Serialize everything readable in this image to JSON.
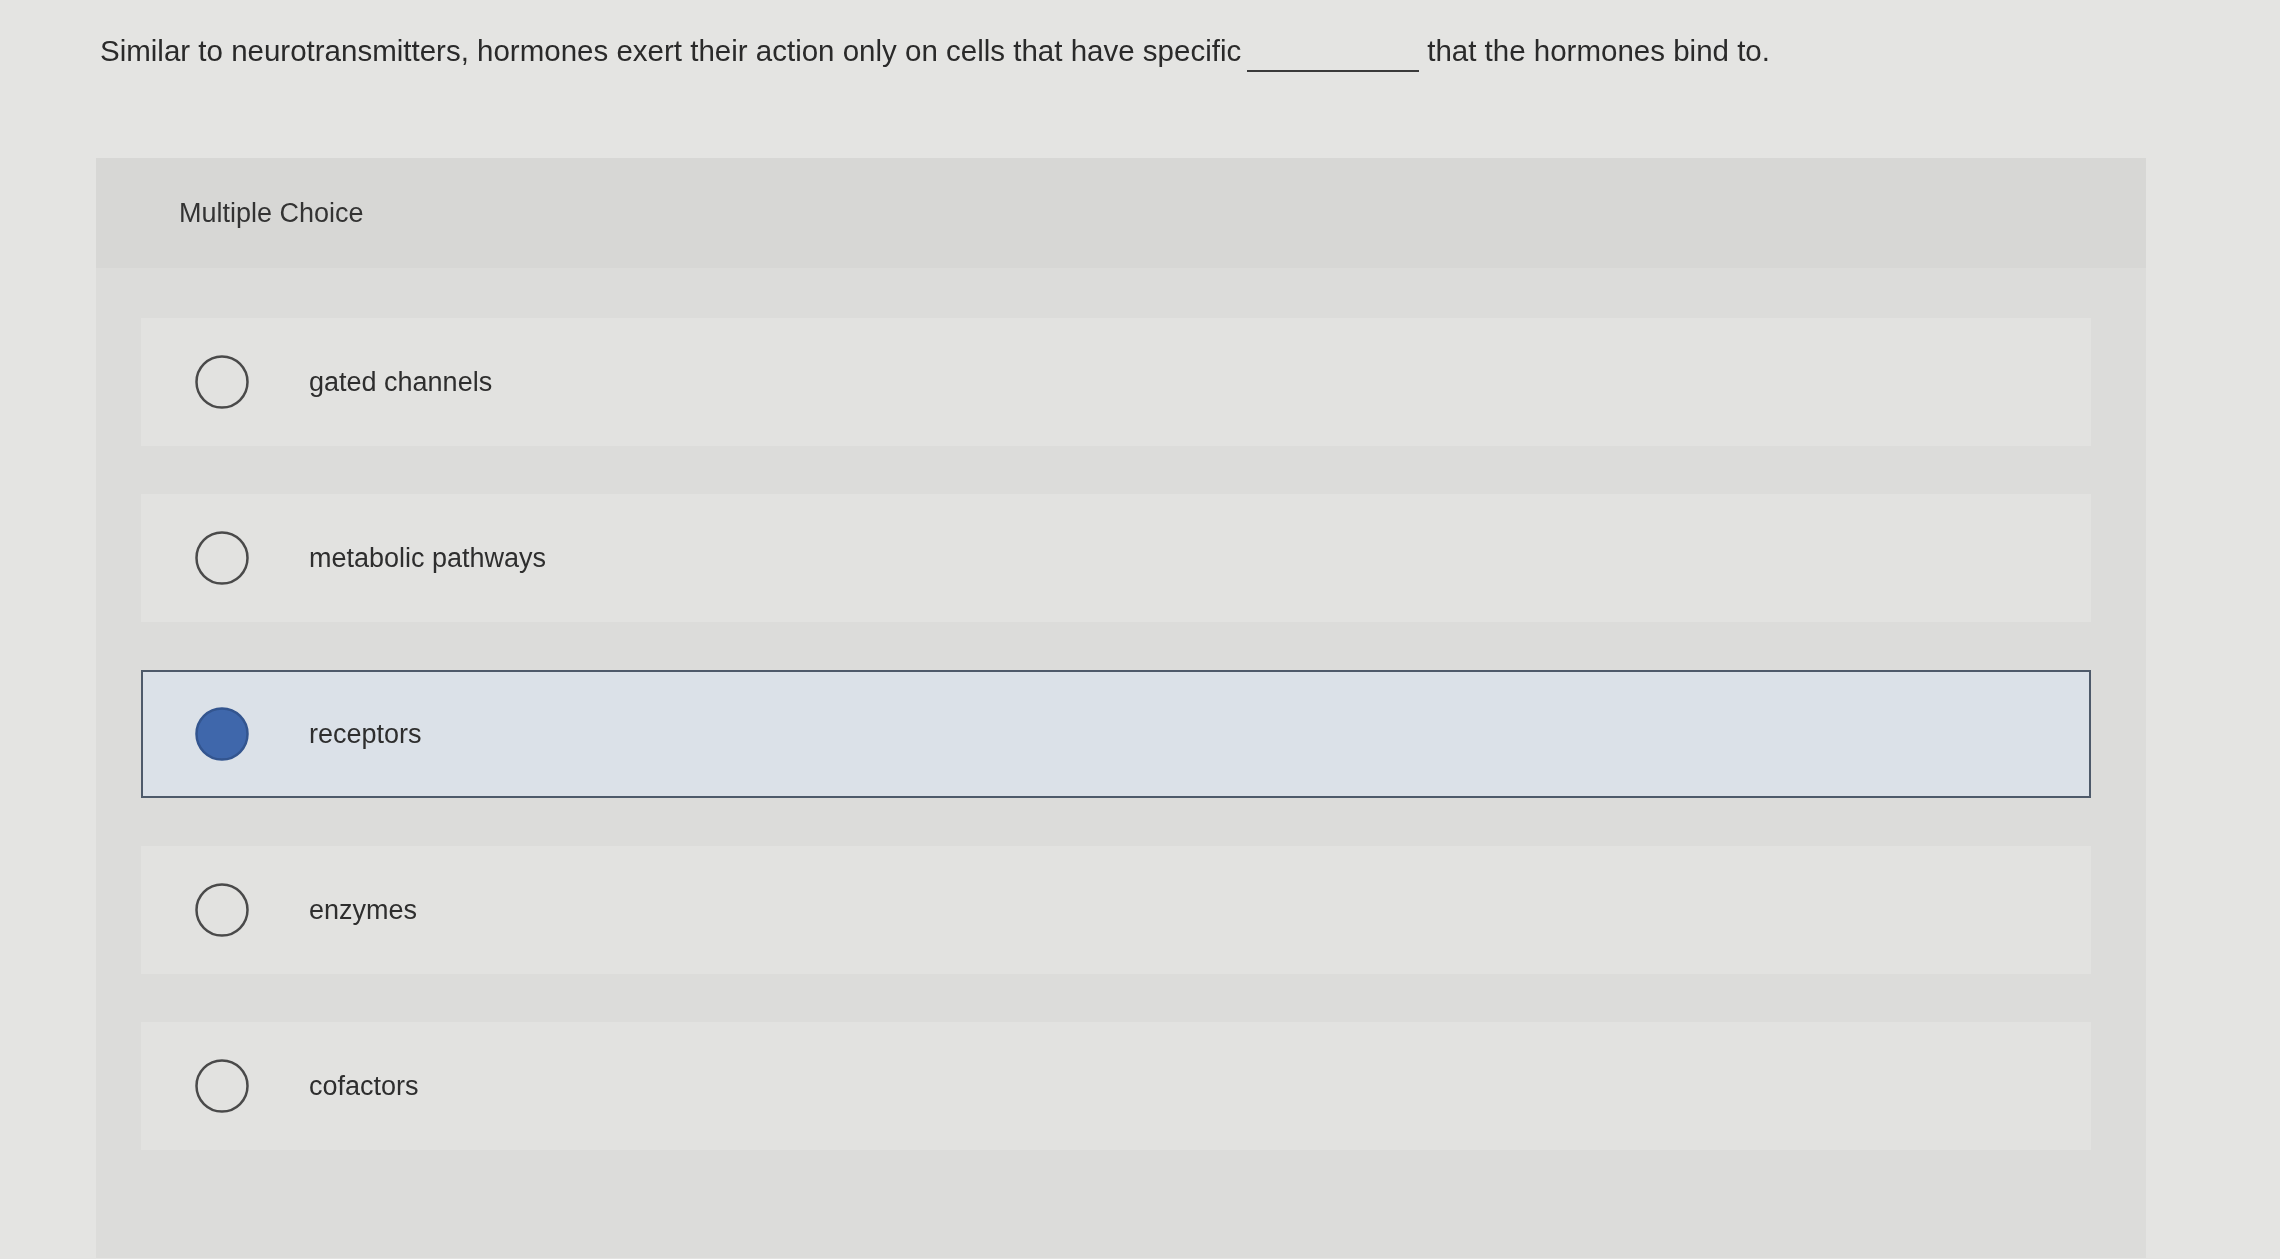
{
  "question": {
    "text_before": "Similar to neurotransmitters, hormones exert their action only on cells that have specific",
    "text_after": "that the hormones bind to."
  },
  "panel": {
    "heading": "Multiple Choice"
  },
  "options": [
    {
      "label": "gated channels",
      "selected": false
    },
    {
      "label": "metabolic pathways",
      "selected": false
    },
    {
      "label": "receptors",
      "selected": true
    },
    {
      "label": "enzymes",
      "selected": false
    },
    {
      "label": "cofactors",
      "selected": false
    }
  ]
}
